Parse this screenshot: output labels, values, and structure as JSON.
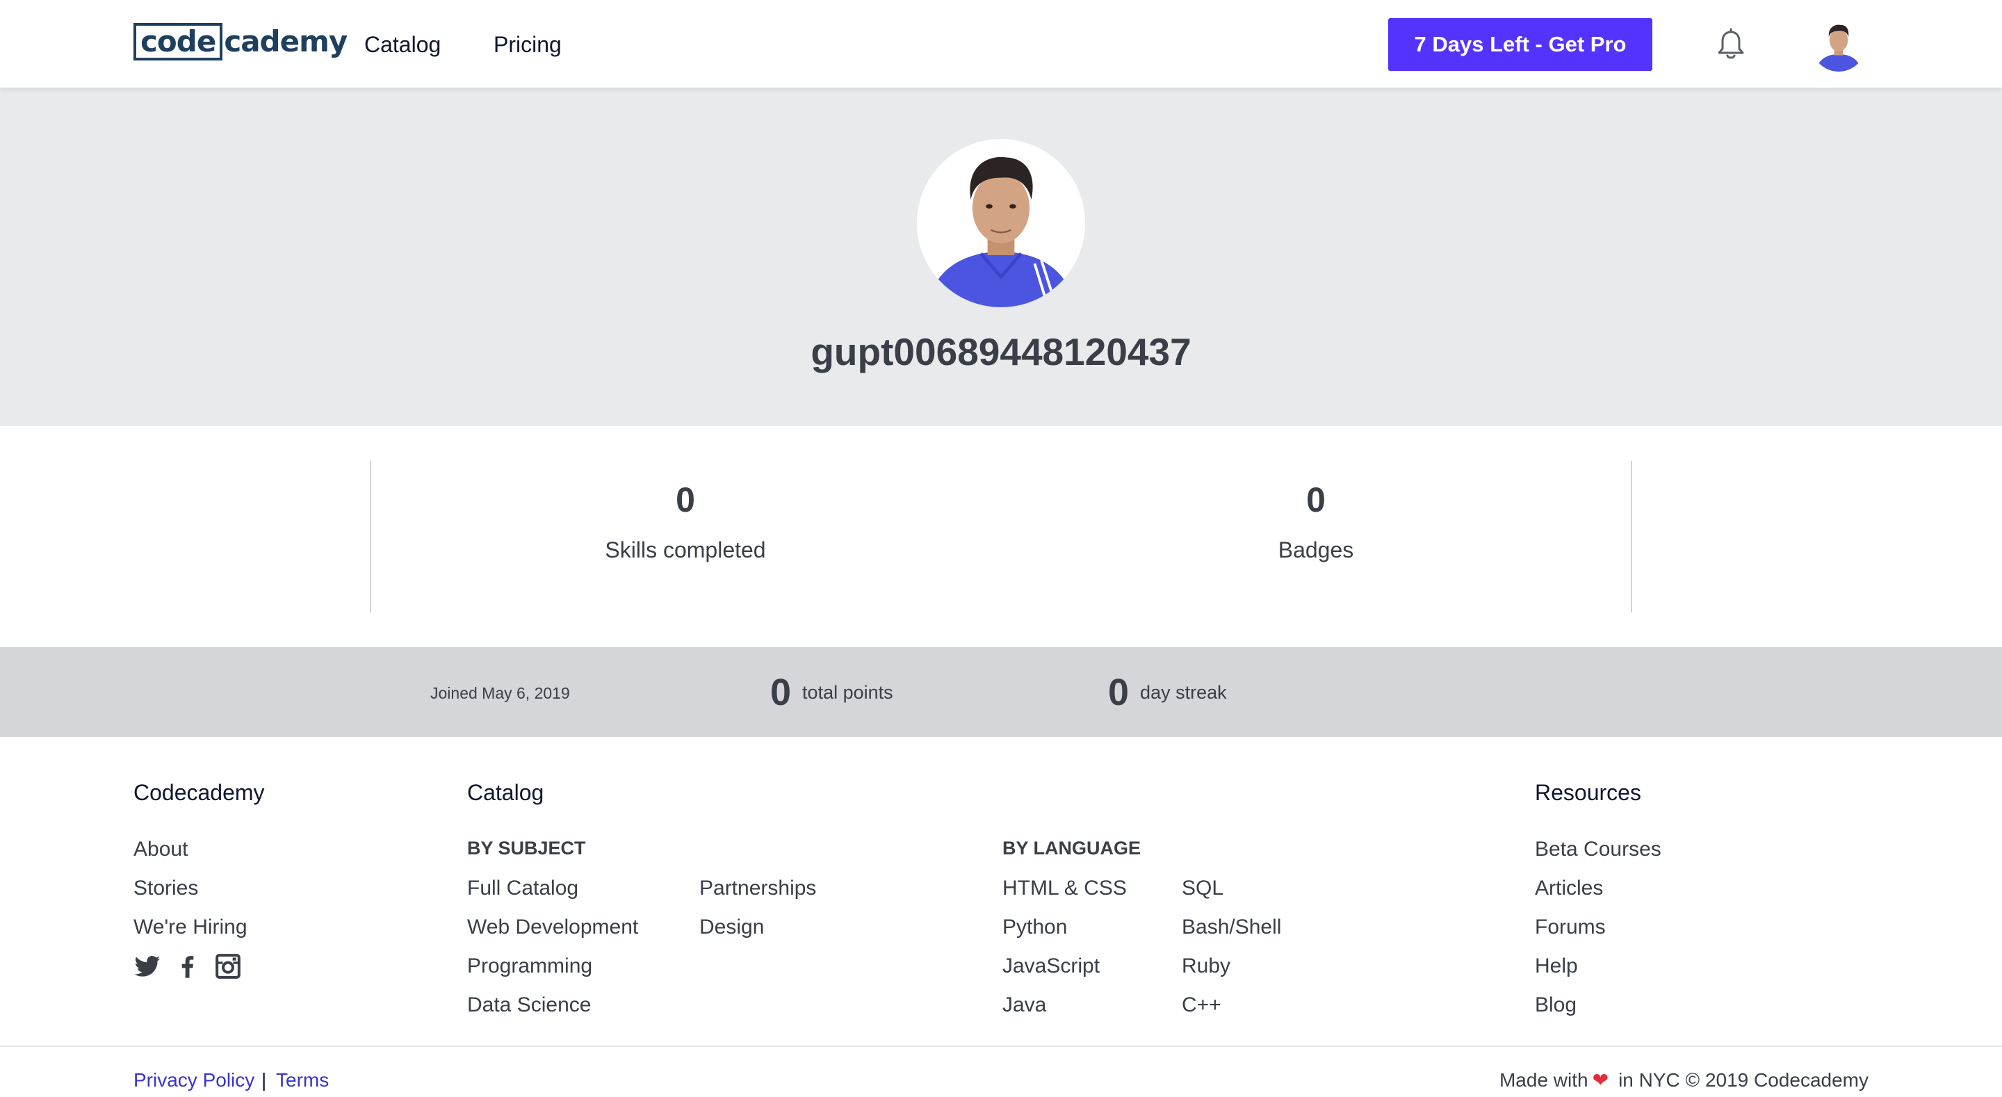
{
  "header": {
    "logo_boxed": "code",
    "logo_rest": "cademy",
    "nav": [
      {
        "label": "Catalog"
      },
      {
        "label": "Pricing"
      }
    ],
    "cta_label": "7 Days Left - Get Pro",
    "bell_icon": "bell-icon",
    "avatar_icon": "user-avatar"
  },
  "profile": {
    "username": "gupt00689448120437"
  },
  "stats": [
    {
      "value": "0",
      "label": "Skills completed"
    },
    {
      "value": "0",
      "label": "Badges"
    }
  ],
  "meta": {
    "joined": "Joined May 6, 2019",
    "points_value": "0",
    "points_label": "total points",
    "streak_value": "0",
    "streak_label": "day streak"
  },
  "footer": {
    "codecademy": {
      "title": "Codecademy",
      "links": [
        "About",
        "Stories",
        "We're Hiring"
      ],
      "social": [
        "twitter-icon",
        "facebook-icon",
        "instagram-icon"
      ]
    },
    "catalog": {
      "title": "Catalog",
      "by_subject_label": "BY SUBJECT",
      "subject_col1": [
        "Full Catalog",
        "Web Development",
        "Programming",
        "Data Science"
      ],
      "subject_col2": [
        "Partnerships",
        "Design"
      ],
      "by_language_label": "BY LANGUAGE",
      "language_col1": [
        "HTML & CSS",
        "Python",
        "JavaScript",
        "Java"
      ],
      "language_col2": [
        "SQL",
        "Bash/Shell",
        "Ruby",
        "C++"
      ]
    },
    "resources": {
      "title": "Resources",
      "links": [
        "Beta Courses",
        "Articles",
        "Forums",
        "Help",
        "Blog"
      ]
    },
    "legal": {
      "privacy": "Privacy Policy",
      "separator": "|",
      "terms": "Terms"
    },
    "made_with_prefix": "Made with",
    "made_with_suffix": "in NYC © 2019 Codecademy"
  },
  "colors": {
    "brand_purple": "#5533ff",
    "link_blue": "#3a34c9",
    "banner_bg": "#e8eaeb",
    "meta_bg": "#d4d6d9"
  }
}
